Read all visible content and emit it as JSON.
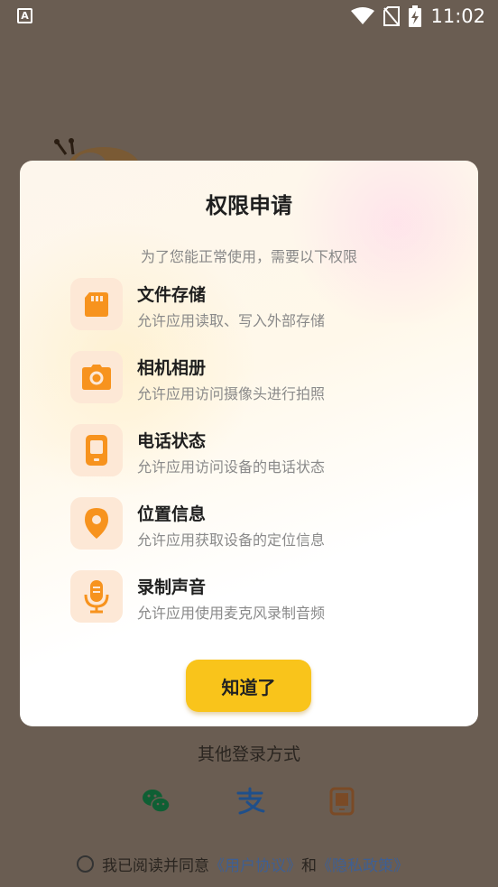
{
  "status_bar": {
    "left_icon_letter": "A",
    "time": "11:02",
    "icons": [
      "wifi-icon",
      "no-sim-icon",
      "battery-charging-icon"
    ]
  },
  "dialog": {
    "title": "权限申请",
    "subtitle": "为了您能正常使用，需要以下权限",
    "permissions": [
      {
        "icon": "sd-card-icon",
        "title": "文件存储",
        "desc": "允许应用读取、写入外部存储"
      },
      {
        "icon": "camera-icon",
        "title": "相机相册",
        "desc": "允许应用访问摄像头进行拍照"
      },
      {
        "icon": "phone-icon",
        "title": "电话状态",
        "desc": "允许应用访问设备的电话状态"
      },
      {
        "icon": "location-icon",
        "title": "位置信息",
        "desc": "允许应用获取设备的定位信息"
      },
      {
        "icon": "microphone-icon",
        "title": "录制声音",
        "desc": "允许应用使用麦克风录制音频"
      }
    ],
    "confirm_label": "知道了"
  },
  "bottom": {
    "other_login_label": "其他登录方式",
    "login_options": [
      "wechat-icon",
      "alipay-icon",
      "phone-login-icon"
    ],
    "agreement": {
      "prefix": "我已阅读并同意",
      "user_agreement": "《用户协议》",
      "and": "和",
      "privacy_policy": "《隐私政策》"
    }
  },
  "colors": {
    "accent": "#f9c41b",
    "icon_orange": "#f7931e",
    "link": "#3f5f92",
    "overlay": "#6a5d52"
  }
}
